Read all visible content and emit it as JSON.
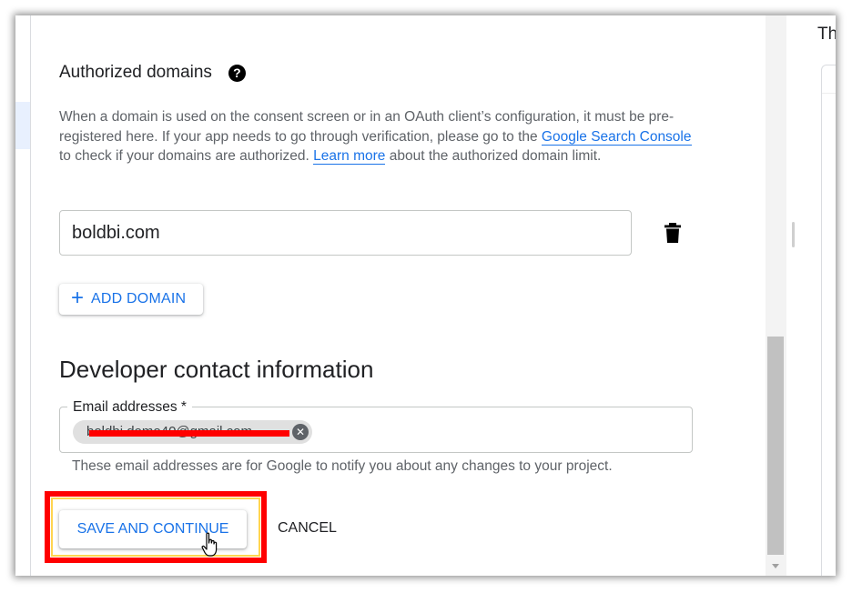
{
  "authorized_domains": {
    "title": "Authorized domains",
    "help_icon": "help-circle-icon",
    "description": {
      "part1": "When a domain is used on the consent screen or in an OAuth client’s configuration, it must be pre-registered here. If your app needs to go through verification, please go to the ",
      "link1": "Google Search Console",
      "part2": " to check if your domains are authorized. ",
      "link2": "Learn more",
      "part3": " about the authorized domain limit."
    },
    "domain_value": "boldbi.com",
    "delete_icon": "trash-icon",
    "add_domain_label": "ADD DOMAIN"
  },
  "developer_contact": {
    "title": "Developer contact information",
    "email_label": "Email addresses *",
    "email_chip": "boldbi.demo40@gmail.com",
    "chip_remove_icon": "close-circle-icon",
    "helper_text": "These email addresses are for Google to notify you about any changes to your project."
  },
  "actions": {
    "save_label": "SAVE AND CONTINUE",
    "cancel_label": "CANCEL"
  },
  "right_panel": {
    "text": "Th"
  },
  "colors": {
    "accent": "#1a73e8",
    "annotation_red": "#ff0000",
    "annotation_yellow": "#ffd54f",
    "text_primary": "#202124",
    "text_secondary": "#5f6368"
  }
}
